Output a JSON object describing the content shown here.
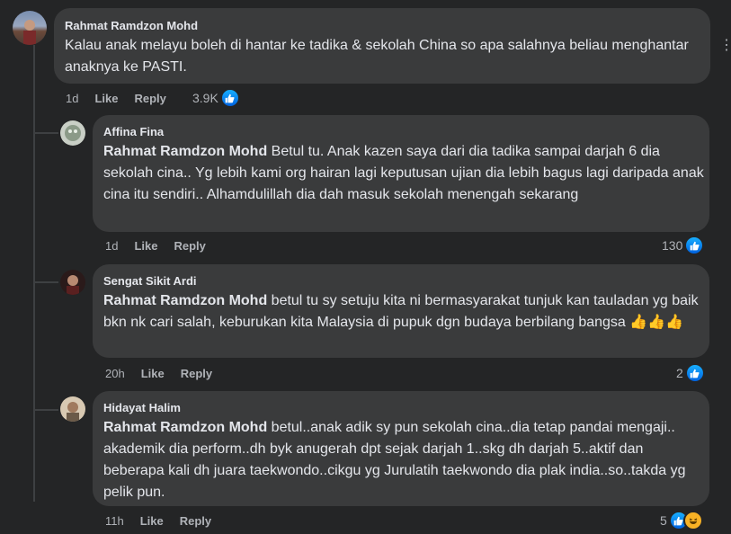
{
  "comments": [
    {
      "author": "Rahmat Ramdzon Mohd",
      "text": "Kalau anak melayu boleh di hantar ke tadika & sekolah China so apa salahnya beliau menghantar anaknya ke PASTI.",
      "time": "1d",
      "like": "Like",
      "reply": "Reply",
      "count": "3.9K",
      "reactions": [
        "like"
      ]
    },
    {
      "author": "Affina Fina",
      "mention": "Rahmat Ramdzon Mohd",
      "text": " Betul tu. Anak kazen saya dari dia tadika sampai darjah 6 dia sekolah cina.. Yg lebih kami org hairan lagi keputusan ujian dia lebih bagus lagi daripada anak cina itu sendiri.. Alhamdulillah dia dah masuk sekolah menengah sekarang",
      "time": "1d",
      "like": "Like",
      "reply": "Reply",
      "count": "130",
      "reactions": [
        "like"
      ]
    },
    {
      "author": "Sengat Sikit Ardi",
      "mention": "Rahmat Ramdzon Mohd",
      "text": " betul tu sy setuju kita ni bermasyarakat tunjuk kan tauladan yg baik bkn nk cari salah, keburukan kita Malaysia di pupuk dgn budaya berbilang bangsa 👍👍👍",
      "time": "20h",
      "like": "Like",
      "reply": "Reply",
      "count": "2",
      "reactions": [
        "like"
      ]
    },
    {
      "author": "Hidayat Halim",
      "mention": "Rahmat Ramdzon Mohd",
      "text": " betul..anak adik sy pun sekolah cina..dia tetap pandai mengaji.. akademik dia perform..dh byk anugerah dpt sejak darjah 1..skg dh darjah 5..aktif dan beberapa kali dh juara taekwondo..cikgu yg Jurulatih taekwondo dia plak india..so..takda yg pelik pun.",
      "time": "11h",
      "like": "Like",
      "reply": "Reply",
      "count": "5",
      "reactions": [
        "like",
        "haha"
      ]
    }
  ],
  "more_icon": "more-horizontal-icon",
  "colors": {
    "background": "#242526",
    "bubble": "#3a3b3c",
    "text": "#e4e6eb",
    "meta": "#b0b3b8",
    "like": "#1877f2"
  }
}
